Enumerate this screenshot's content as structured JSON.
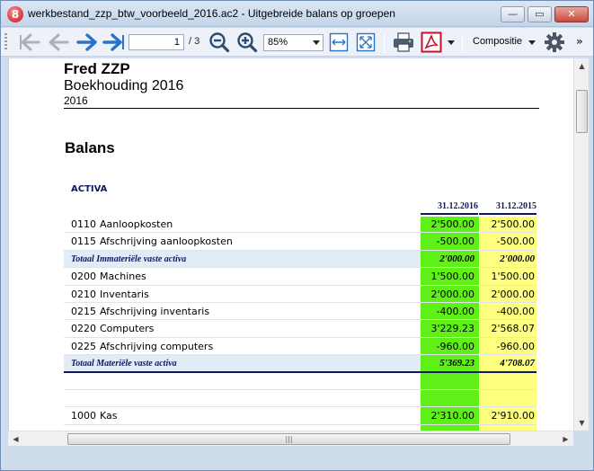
{
  "window": {
    "title": "werkbestand_zzp_btw_voorbeeld_2016.ac2 - Uitgebreide balans op groepen",
    "minimize": "—",
    "maximize": "▭",
    "close": "✕"
  },
  "toolbar": {
    "page_current": "1",
    "page_total": "/ 3",
    "zoom": "85%",
    "layout": "Compositie",
    "more": "»",
    "icons": [
      "first-page-icon",
      "previous-page-icon",
      "next-page-icon",
      "last-page-icon",
      "zoom-out-icon",
      "zoom-in-icon",
      "fit-width-icon",
      "fit-page-icon",
      "print-icon",
      "pdf-icon",
      "settings-icon"
    ]
  },
  "report": {
    "company": "Fred ZZP",
    "subtitle": "Boekhouding 2016",
    "year": "2016",
    "title": "Balans",
    "section": "ACTIVA",
    "col1": "31.12.2016",
    "col2": "31.12.2015",
    "rows": [
      {
        "acct": "0110",
        "desc": "Aanloopkosten",
        "v1": "2'500.00",
        "v2": "2'500.00"
      },
      {
        "acct": "0115",
        "desc": "Afschrijving aanloopkosten",
        "v1": "-500.00",
        "v2": "-500.00"
      },
      {
        "acct": "",
        "desc": "Totaal Immateriële vaste activa",
        "v1": "2'000.00",
        "v2": "2'000.00",
        "total": true
      },
      {
        "acct": "0200",
        "desc": "Machines",
        "v1": "1'500.00",
        "v2": "1'500.00"
      },
      {
        "acct": "0210",
        "desc": "Inventaris",
        "v1": "2'000.00",
        "v2": "2'000.00"
      },
      {
        "acct": "0215",
        "desc": "Afschrijving inventaris",
        "v1": "-400.00",
        "v2": "-400.00"
      },
      {
        "acct": "0220",
        "desc": "Computers",
        "v1": "3'229.23",
        "v2": "2'568.07"
      },
      {
        "acct": "0225",
        "desc": "Afschrijving computers",
        "v1": "-960.00",
        "v2": "-960.00"
      },
      {
        "acct": "",
        "desc": "Totaal Materiële vaste activa",
        "v1": "5'369.23",
        "v2": "4'708.07",
        "total": true,
        "double": true
      },
      {
        "acct": "",
        "desc": "",
        "v1": "",
        "v2": ""
      },
      {
        "acct": "",
        "desc": "",
        "v1": "",
        "v2": ""
      },
      {
        "acct": "1000",
        "desc": "Kas",
        "v1": "2'310.00",
        "v2": "2'910.00"
      }
    ]
  },
  "colors": {
    "col_current_bg": "#5ff018",
    "col_previous_bg": "#ffff80",
    "total_row_bg": "#e2ecf6",
    "header_text": "#0f1a5c",
    "arrow_active": "#2a72c8",
    "arrow_inactive": "#a9b2bc"
  }
}
